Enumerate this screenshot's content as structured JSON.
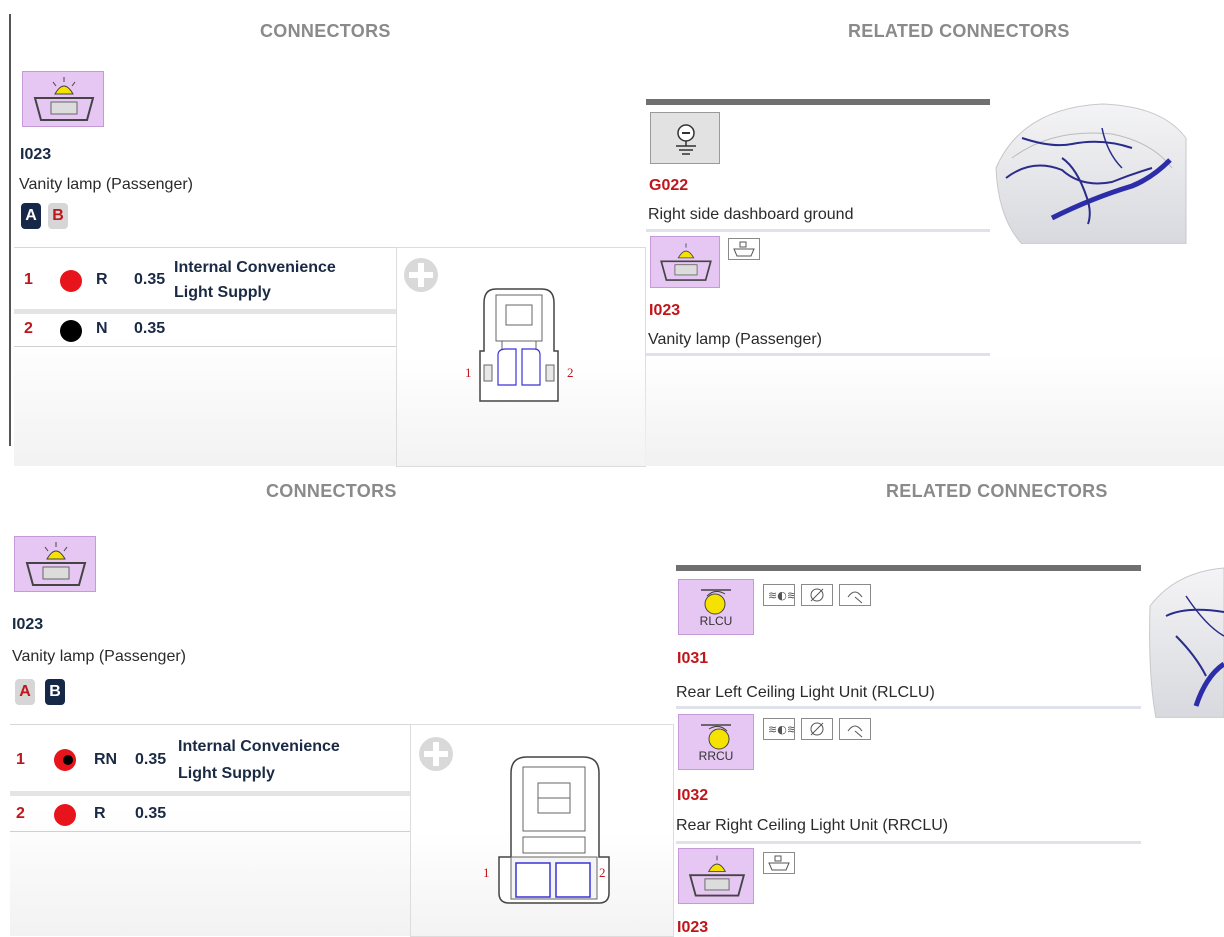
{
  "top": {
    "connectors_heading": "CONNECTORS",
    "related_heading": "RELATED CONNECTORS",
    "connector": {
      "code": "I023",
      "name": "Vanity lamp (Passenger)",
      "variant_a": "A",
      "variant_b": "B",
      "active_variant": "A"
    },
    "pins": [
      {
        "num": "1",
        "color_code": "R",
        "size": "0.35",
        "function_line1": "Internal Convenience",
        "function_line2": "Light Supply",
        "dot_color": "#e8141b"
      },
      {
        "num": "2",
        "color_code": "N",
        "size": "0.35",
        "function_line1": "",
        "function_line2": "",
        "dot_color": "#000000"
      }
    ],
    "diagram_pins": {
      "left": "1",
      "right": "2"
    },
    "related": [
      {
        "code": "G022",
        "name": "Right side dashboard ground",
        "icon": "ground-icon"
      },
      {
        "code": "I023",
        "name": "Vanity lamp (Passenger)",
        "icon": "vanity-lamp-icon"
      }
    ]
  },
  "bottom": {
    "connectors_heading": "CONNECTORS",
    "related_heading": "RELATED CONNECTORS",
    "connector": {
      "code": "I023",
      "name": "Vanity lamp (Passenger)",
      "variant_a": "A",
      "variant_b": "B",
      "active_variant": "B"
    },
    "pins": [
      {
        "num": "1",
        "color_code": "RN",
        "size": "0.35",
        "function_line1": "Internal Convenience",
        "function_line2": "Light Supply",
        "dot_color": "#e8141b"
      },
      {
        "num": "2",
        "color_code": "R",
        "size": "0.35",
        "function_line1": "",
        "function_line2": "",
        "dot_color": "#e8141b"
      }
    ],
    "diagram_pins": {
      "left": "1",
      "right": "2"
    },
    "related": [
      {
        "code": "I031",
        "name": "Rear Left Ceiling Light Unit (RLCLU)",
        "icon_label": "RLCU",
        "icon": "ceiling-light-icon"
      },
      {
        "code": "I032",
        "name": "Rear Right Ceiling Light Unit (RRCLU)",
        "icon_label": "RRCU",
        "icon": "ceiling-light-icon"
      },
      {
        "code": "I023",
        "name": "",
        "icon": "vanity-lamp-icon"
      }
    ]
  },
  "colors": {
    "accent_dark": "#152848",
    "code_red": "#c0161b",
    "icon_bg": "#e6c6f2"
  }
}
